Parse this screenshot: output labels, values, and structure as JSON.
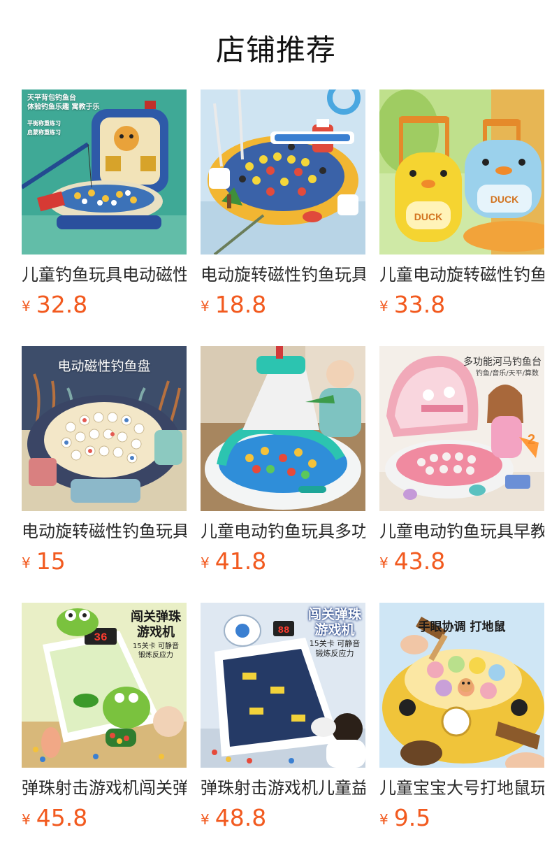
{
  "header": {
    "title": "店铺推荐"
  },
  "currency_symbol": "¥",
  "products": [
    {
      "name": "儿童钓鱼玩具电动磁性",
      "price": "32.8",
      "image_text": [
        "天平背包钓鱼台",
        "体验钓鱼乐趣 寓教于乐",
        "平衡称重练习",
        "启蒙称重练习"
      ],
      "bg": "#3fa996"
    },
    {
      "name": "电动旋转磁性钓鱼玩具",
      "price": "18.8",
      "image_text": [],
      "bg": "#cfe4f2"
    },
    {
      "name": "儿童电动旋转磁性钓鱼",
      "price": "33.8",
      "image_text": [
        "DUCK",
        "DUCK"
      ],
      "bg": "#cfe9a6"
    },
    {
      "name": "电动旋转磁性钓鱼玩具",
      "price": "15",
      "image_text": [
        "电动磁性钓鱼盘"
      ],
      "bg": "#dbcfb0"
    },
    {
      "name": "儿童电动钓鱼玩具多功能",
      "price": "41.8",
      "image_text": [],
      "bg": "#a7865f"
    },
    {
      "name": "儿童电动钓鱼玩具早教",
      "price": "43.8",
      "image_text": [
        "多功能河马钓鱼台",
        "钓鱼/音乐/天平/算数"
      ],
      "bg": "#f4efe9"
    },
    {
      "name": "弹珠射击游戏机闯关弹珠",
      "price": "45.8",
      "image_text": [
        "闯关弹珠",
        "游戏机",
        "15关卡 可静音",
        "锻炼反应力",
        "36"
      ],
      "bg": "#e9efc6"
    },
    {
      "name": "弹珠射击游戏机儿童益智",
      "price": "48.8",
      "image_text": [
        "闯关弹珠",
        "游戏机",
        "15关卡 可静音",
        "锻炼反应力",
        "88"
      ],
      "bg": "#dfe8f2"
    },
    {
      "name": "儿童宝宝大号打地鼠玩具",
      "price": "9.5",
      "image_text": [
        "手眼协调 打地鼠"
      ],
      "bg": "#cfe6f5"
    }
  ]
}
